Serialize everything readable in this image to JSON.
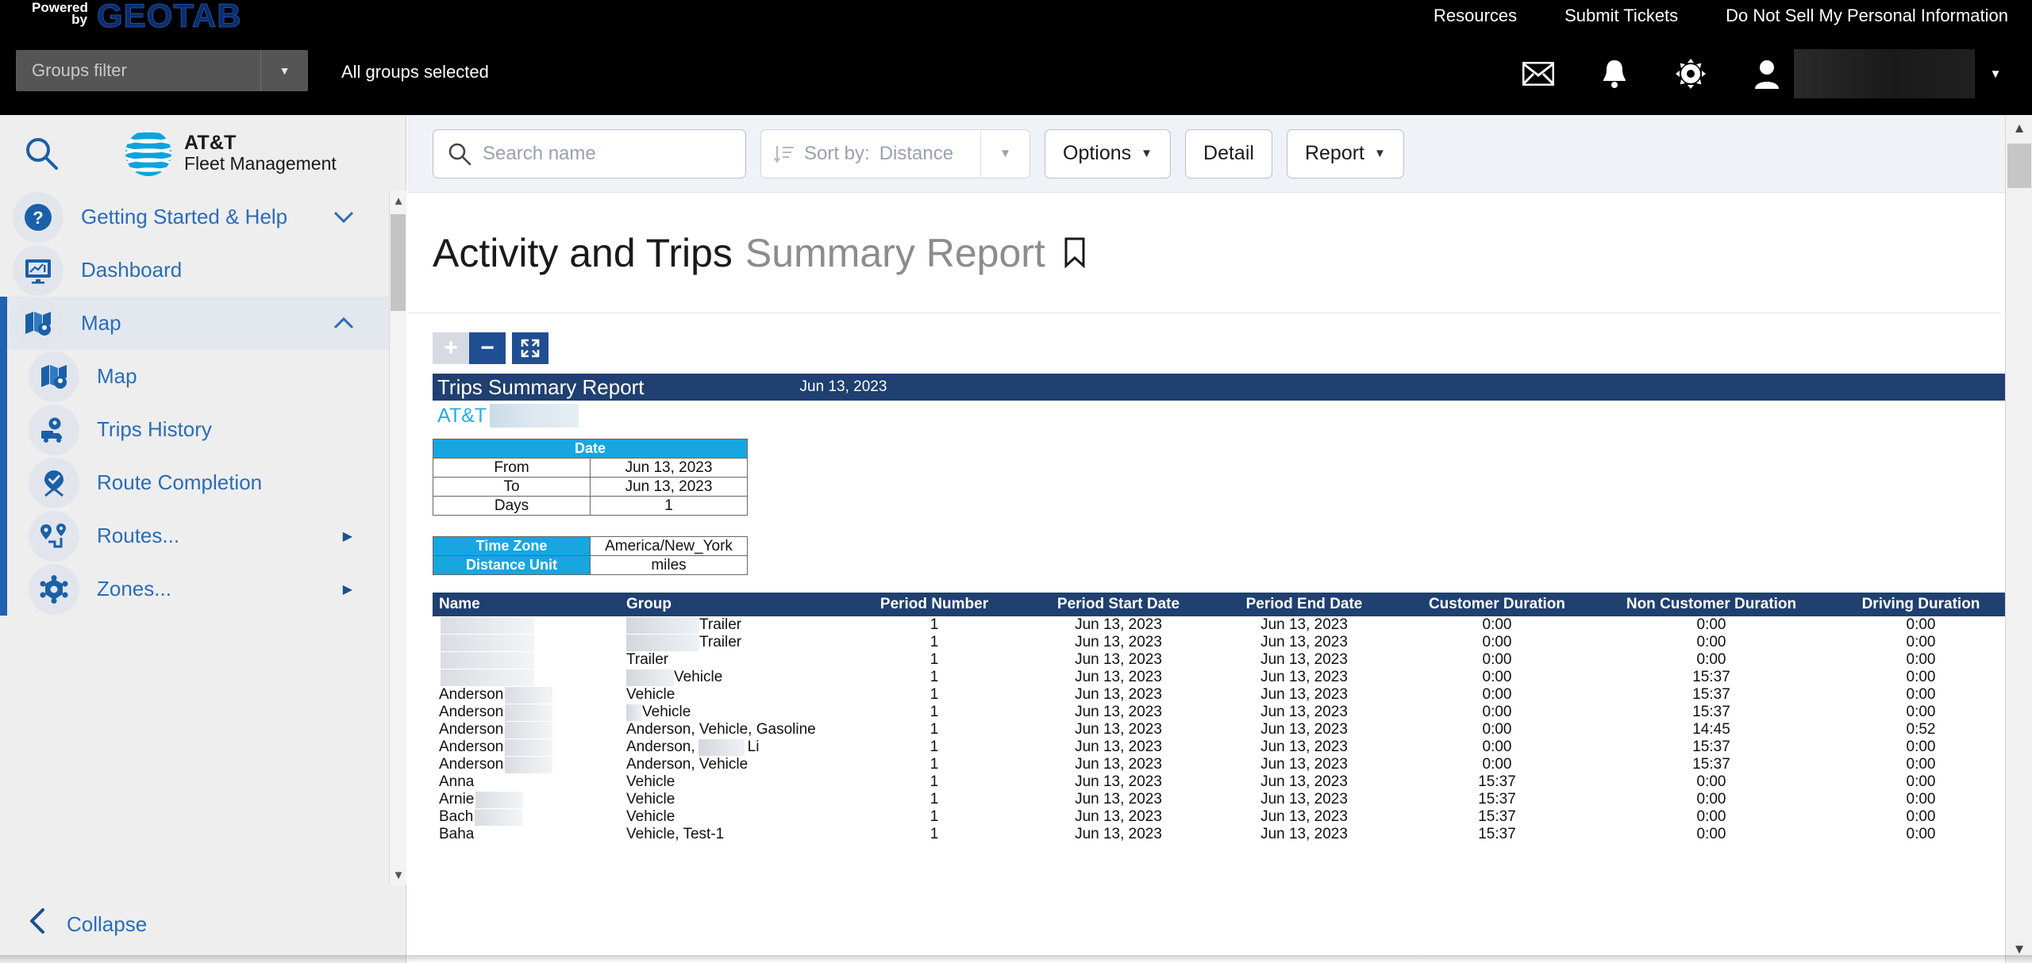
{
  "topbar": {
    "powered_line1": "Powered",
    "powered_line2": "by",
    "brand": "GEOTAB",
    "links": [
      {
        "label": "Resources"
      },
      {
        "label": "Submit Tickets"
      },
      {
        "label": "Do Not Sell My Personal Information"
      }
    ],
    "groups_filter_placeholder": "Groups filter",
    "groups_selected": "All groups selected",
    "icons": [
      {
        "name": "mail-icon"
      },
      {
        "name": "bell-icon"
      },
      {
        "name": "gear-icon"
      },
      {
        "name": "user-icon"
      }
    ],
    "user_name": "",
    "user_caret": "▼"
  },
  "sidebar": {
    "search_icon": "search-icon",
    "brand_line1": "AT&T",
    "brand_line2": "Fleet Management",
    "items": [
      {
        "label": "Getting Started & Help",
        "icon": "question-circle-icon",
        "chevron": "⌄",
        "expanded": false,
        "sub": false
      },
      {
        "label": "Dashboard",
        "icon": "dashboard-icon",
        "chevron": "",
        "expanded": false,
        "sub": false
      },
      {
        "label": "Map",
        "icon": "map-icon",
        "chevron": "⌃",
        "expanded": true,
        "sub": false
      },
      {
        "label": "Map",
        "icon": "map-icon",
        "chevron": "",
        "sub": true
      },
      {
        "label": "Trips History",
        "icon": "trips-history-icon",
        "chevron": "",
        "sub": true
      },
      {
        "label": "Route Completion",
        "icon": "route-completion-icon",
        "chevron": "",
        "sub": true
      },
      {
        "label": "Routes...",
        "icon": "routes-icon",
        "chevron": "▶",
        "sub": true
      },
      {
        "label": "Zones...",
        "icon": "zones-icon",
        "chevron": "▶",
        "sub": true
      }
    ],
    "collapse_label": "Collapse"
  },
  "toolbar": {
    "search_placeholder": "Search name",
    "sort_label": "Sort by:",
    "sort_value": "Distance",
    "options_label": "Options",
    "detail_label": "Detail",
    "report_label": "Report",
    "caret": "▼"
  },
  "page": {
    "title_main": "Activity and Trips",
    "title_sub": "Summary Report",
    "bookmark_icon": "bookmark-icon"
  },
  "report": {
    "zoom_in": "+",
    "zoom_out": "−",
    "fit": "fit-to-screen-icon",
    "header_title": "Trips Summary Report",
    "header_date": "Jun 13, 2023",
    "company": "AT&T",
    "company_redacted": true,
    "date_table": {
      "header": "Date",
      "rows": [
        {
          "key": "From",
          "value": "Jun 13, 2023"
        },
        {
          "key": "To",
          "value": "Jun 13, 2023"
        },
        {
          "key": "Days",
          "value": "1"
        }
      ]
    },
    "meta_table": {
      "rows": [
        {
          "key": "Time Zone",
          "value": "America/New_York"
        },
        {
          "key": "Distance Unit",
          "value": "miles"
        }
      ]
    },
    "grid": {
      "columns": [
        "Name",
        "Group",
        "Period Number",
        "Period Start Date",
        "Period End Date",
        "Customer Duration",
        "Non Customer Duration",
        "Driving Duration"
      ],
      "rows": [
        {
          "name": "",
          "name_redacted": 118,
          "group": "Trailer",
          "group_redacted": 92,
          "period_number": "1",
          "start": "Jun 13, 2023",
          "end": "Jun 13, 2023",
          "customer": "0:00",
          "non_customer": "0:00",
          "driving": "0:00"
        },
        {
          "name": "",
          "name_redacted": 118,
          "group": "Trailer",
          "group_redacted": 92,
          "period_number": "1",
          "start": "Jun 13, 2023",
          "end": "Jun 13, 2023",
          "customer": "0:00",
          "non_customer": "0:00",
          "driving": "0:00"
        },
        {
          "name": "",
          "name_redacted": 118,
          "group": "Trailer",
          "group_redacted": 0,
          "period_number": "1",
          "start": "Jun 13, 2023",
          "end": "Jun 13, 2023",
          "customer": "0:00",
          "non_customer": "0:00",
          "driving": "0:00"
        },
        {
          "name": "",
          "name_redacted": 118,
          "group": "Vehicle",
          "group_redacted": 60,
          "period_number": "1",
          "start": "Jun 13, 2023",
          "end": "Jun 13, 2023",
          "customer": "0:00",
          "non_customer": "15:37",
          "driving": "0:00"
        },
        {
          "name": "Anderson",
          "name_redacted": 60,
          "group": "Vehicle",
          "group_redacted": 0,
          "period_number": "1",
          "start": "Jun 13, 2023",
          "end": "Jun 13, 2023",
          "customer": "0:00",
          "non_customer": "15:37",
          "driving": "0:00"
        },
        {
          "name": "Anderson",
          "name_redacted": 60,
          "group": "Vehicle",
          "group_redacted": 20,
          "period_number": "1",
          "start": "Jun 13, 2023",
          "end": "Jun 13, 2023",
          "customer": "0:00",
          "non_customer": "15:37",
          "driving": "0:00"
        },
        {
          "name": "Anderson",
          "name_redacted": 60,
          "group": "Anderson, Vehicle, Gasoline",
          "group_redacted": 0,
          "period_number": "1",
          "start": "Jun 13, 2023",
          "end": "Jun 13, 2023",
          "customer": "0:00",
          "non_customer": "14:45",
          "driving": "0:52"
        },
        {
          "name": "Anderson",
          "name_redacted": 60,
          "group": "Anderson,",
          "group_redacted": 58,
          "group_tail": "Li",
          "period_number": "1",
          "start": "Jun 13, 2023",
          "end": "Jun 13, 2023",
          "customer": "0:00",
          "non_customer": "15:37",
          "driving": "0:00"
        },
        {
          "name": "Anderson",
          "name_redacted": 60,
          "group": "Anderson, Vehicle",
          "group_redacted": 0,
          "period_number": "1",
          "start": "Jun 13, 2023",
          "end": "Jun 13, 2023",
          "customer": "0:00",
          "non_customer": "15:37",
          "driving": "0:00"
        },
        {
          "name": "Anna",
          "name_redacted": 0,
          "group": "Vehicle",
          "group_redacted": 0,
          "period_number": "1",
          "start": "Jun 13, 2023",
          "end": "Jun 13, 2023",
          "customer": "15:37",
          "non_customer": "0:00",
          "driving": "0:00"
        },
        {
          "name": "Arnie",
          "name_redacted": 60,
          "group": "Vehicle",
          "group_redacted": 0,
          "period_number": "1",
          "start": "Jun 13, 2023",
          "end": "Jun 13, 2023",
          "customer": "15:37",
          "non_customer": "0:00",
          "driving": "0:00"
        },
        {
          "name": "Bach",
          "name_redacted": 60,
          "group": "Vehicle",
          "group_redacted": 0,
          "period_number": "1",
          "start": "Jun 13, 2023",
          "end": "Jun 13, 2023",
          "customer": "15:37",
          "non_customer": "0:00",
          "driving": "0:00"
        },
        {
          "name": "Baha",
          "name_redacted": 0,
          "group": "Vehicle, Test-1",
          "group_redacted": 0,
          "period_number": "1",
          "start": "Jun 13, 2023",
          "end": "Jun 13, 2023",
          "customer": "15:37",
          "non_customer": "0:00",
          "driving": "0:00"
        }
      ]
    }
  },
  "colors": {
    "brand_blue": "#1f4e92",
    "header_navy": "#1f4070",
    "cyan": "#17a6e0",
    "link_blue": "#2b6cb8",
    "att_cyan": "#2aabe2"
  }
}
